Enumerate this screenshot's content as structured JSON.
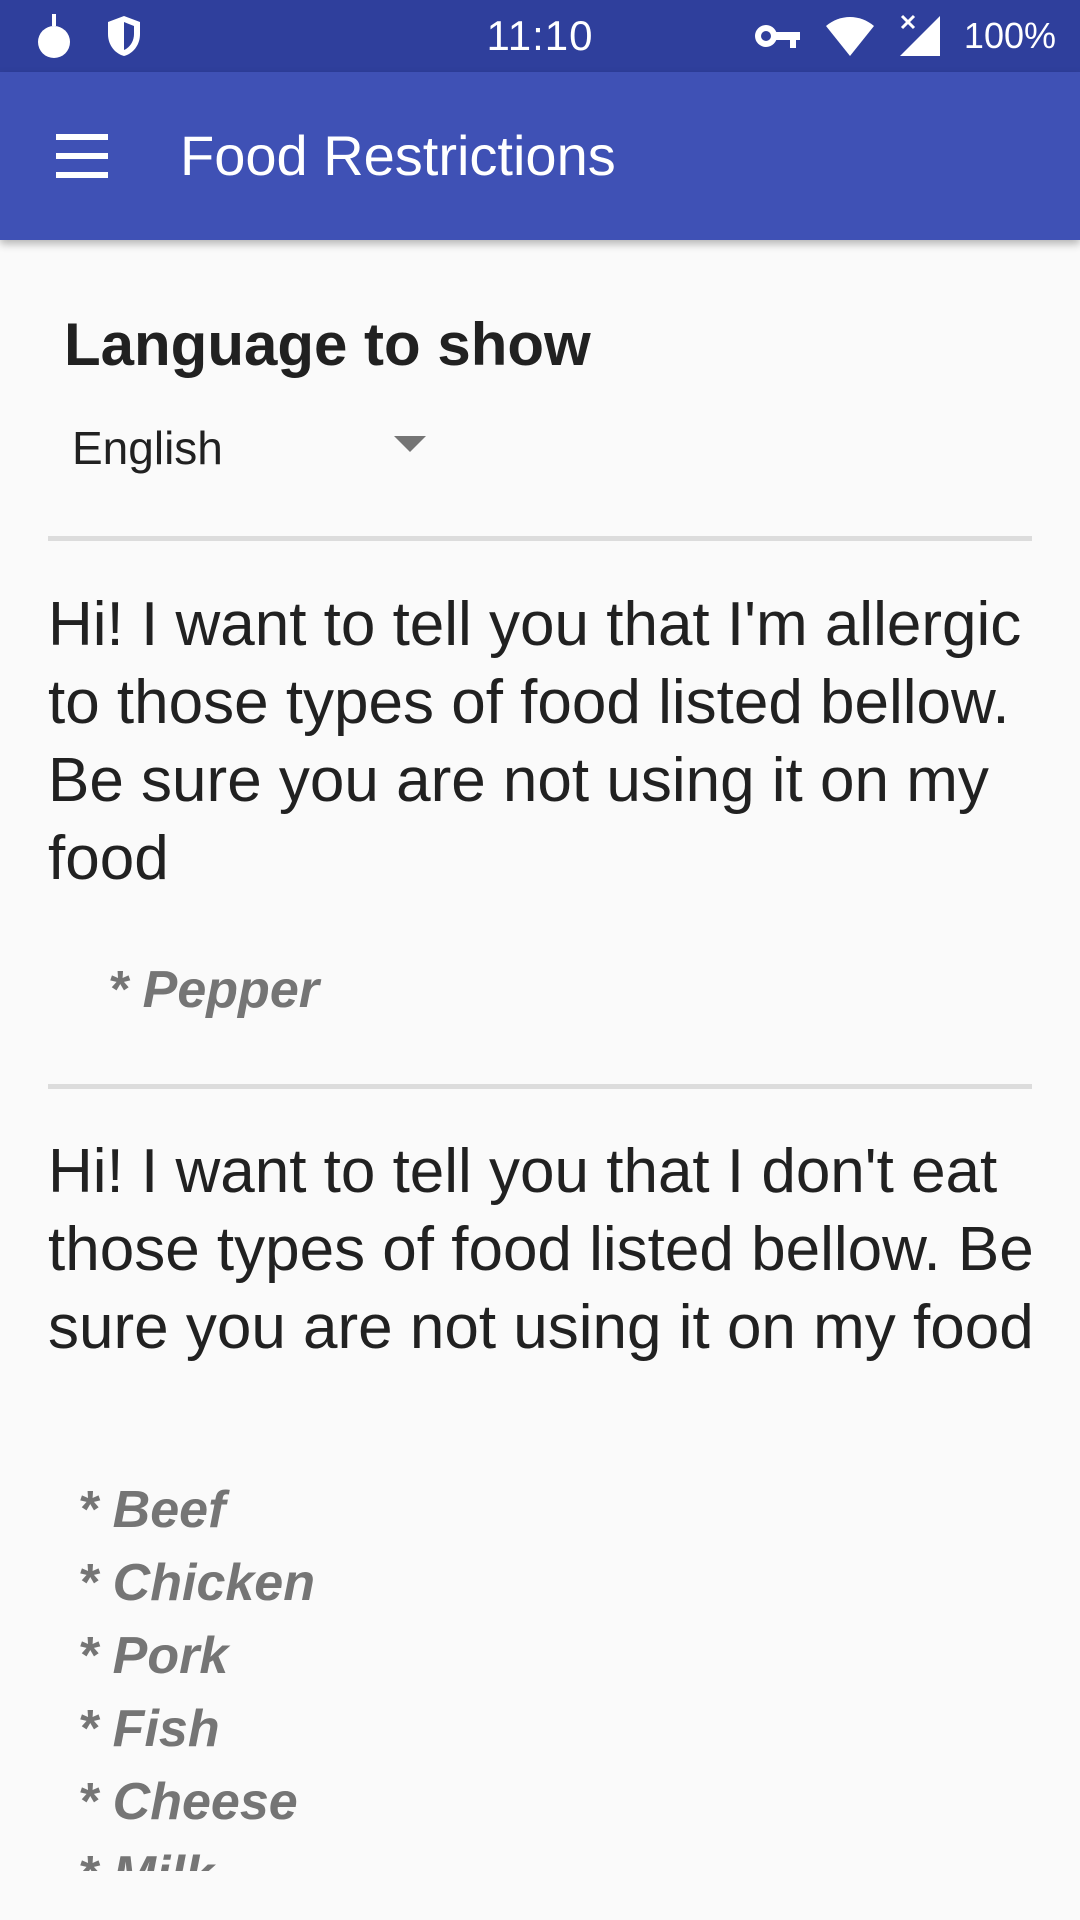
{
  "status_bar": {
    "time": "11:10",
    "battery": "100%",
    "left_icons": [
      "app-drop-icon",
      "shield-icon"
    ],
    "right_icons": [
      "vpn-key-icon",
      "wifi-icon",
      "signal-icon"
    ]
  },
  "app_bar": {
    "title": "Food Restrictions",
    "menu_icon": "hamburger-menu-icon",
    "color": "#3f51b5"
  },
  "language": {
    "heading": "Language to show",
    "selected": "English"
  },
  "allergy_section": {
    "message": "Hi! I want to tell you that I'm allergic to those types of food listed bellow. Be sure you are not using it on my food",
    "items": [
      "* Pepper"
    ]
  },
  "diet_section": {
    "message": "Hi! I want to tell you that I don't eat those types of food listed bellow. Be sure you are not using it on my food",
    "items": [
      "* Beef",
      "* Chicken",
      "* Pork",
      "* Fish",
      "* Cheese",
      "* Milk"
    ]
  }
}
